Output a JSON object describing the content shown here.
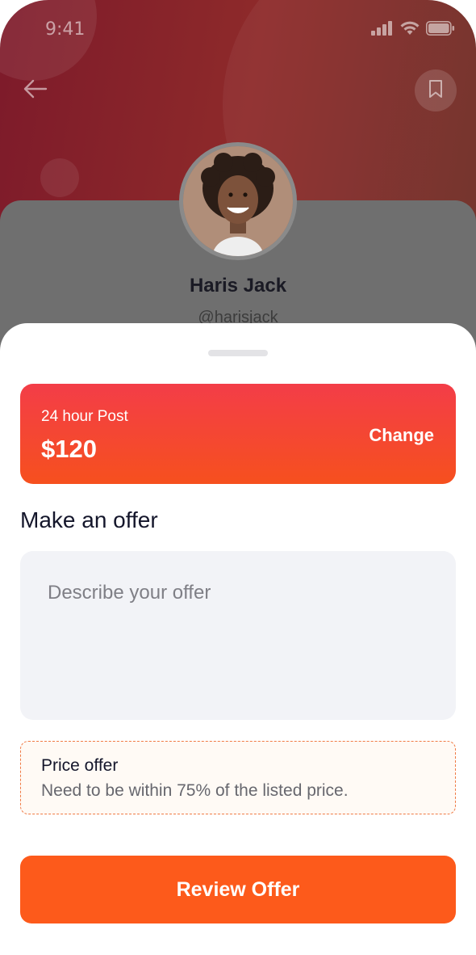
{
  "status_bar": {
    "time": "9:41",
    "icons": [
      "signal-icon",
      "wifi-icon",
      "battery-icon"
    ]
  },
  "header": {
    "back_icon": "arrow-left-icon",
    "bookmark_icon": "bookmark-icon"
  },
  "profile": {
    "name": "Haris Jack",
    "handle": "@harisjack"
  },
  "sheet": {
    "plan": {
      "label": "24 hour Post",
      "price": "$120",
      "change_label": "Change"
    },
    "section_title": "Make an offer",
    "offer_input": {
      "placeholder": "Describe your offer",
      "value": ""
    },
    "notice": {
      "title": "Price offer",
      "text": "Need to be within 75% of the listed price."
    },
    "cta_label": "Review Offer"
  },
  "colors": {
    "accent": "#fd5a1b",
    "plan_gradient_top": "#f33d48",
    "plan_gradient_bottom": "#f6501e",
    "heading": "#14162b",
    "input_bg": "#f2f3f7",
    "notice_border": "#f07a45"
  }
}
